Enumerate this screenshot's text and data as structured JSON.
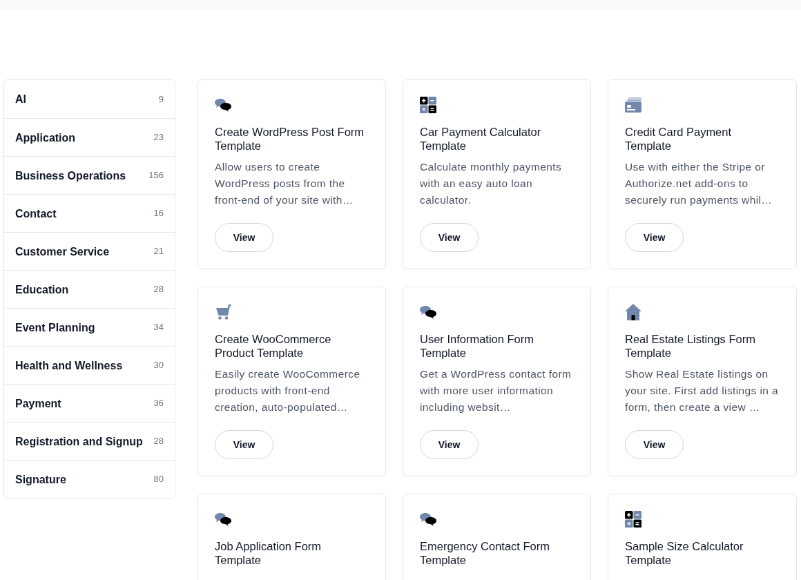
{
  "categories": [
    {
      "name": "AI",
      "count": "9"
    },
    {
      "name": "Application",
      "count": "23"
    },
    {
      "name": "Business Operations",
      "count": "156"
    },
    {
      "name": "Contact",
      "count": "16"
    },
    {
      "name": "Customer Service",
      "count": "21"
    },
    {
      "name": "Education",
      "count": "28"
    },
    {
      "name": "Event Planning",
      "count": "34"
    },
    {
      "name": "Health and Wellness",
      "count": "30"
    },
    {
      "name": "Payment",
      "count": "36"
    },
    {
      "name": "Registration and Signup",
      "count": "28"
    },
    {
      "name": "Signature",
      "count": "80"
    }
  ],
  "templates": [
    {
      "kind": "chat",
      "title": "Create WordPress Post Form Template",
      "description": "Allow users to create WordPress posts from the front-end of your site with…",
      "button": "View"
    },
    {
      "kind": "calculator",
      "title": "Car Payment Calculator Template",
      "description": "Calculate monthly payments with an easy auto loan calculator.",
      "button": "View"
    },
    {
      "kind": "card",
      "title": "Credit Card Payment Template",
      "description": "Use with either the Stripe or Authorize.net add-ons to securely run payments whil…",
      "button": "View"
    },
    {
      "kind": "cart",
      "title": "Create WooCommerce Product Template",
      "description": "Easily create WooCommerce products with front-end creation, auto-populated…",
      "button": "View"
    },
    {
      "kind": "chat",
      "title": "User Information Form Template",
      "description": "Get a WordPress contact form with more user information including websit…",
      "button": "View"
    },
    {
      "kind": "house",
      "title": "Real Estate Listings Form Template",
      "description": "Show Real Estate listings on your site. First add listings in a form, then create a view …",
      "button": "View"
    },
    {
      "kind": "chat",
      "title": "Job Application Form Template"
    },
    {
      "kind": "chat",
      "title": "Emergency Contact Form Template"
    },
    {
      "kind": "calculator",
      "title": "Sample Size Calculator Template"
    }
  ]
}
